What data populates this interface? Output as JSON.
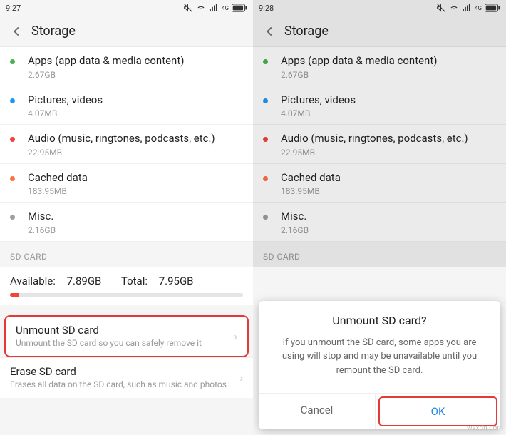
{
  "left": {
    "time": "9:27",
    "header_title": "Storage",
    "items": [
      {
        "dot": "dot-green",
        "title": "Apps (app data & media content)",
        "sub": "2.67GB"
      },
      {
        "dot": "dot-blue",
        "title": "Pictures, videos",
        "sub": "4.07MB"
      },
      {
        "dot": "dot-red",
        "title": "Audio (music, ringtones, podcasts, etc.)",
        "sub": "22.95MB"
      },
      {
        "dot": "dot-orange",
        "title": "Cached data",
        "sub": "183.95MB"
      },
      {
        "dot": "dot-grey",
        "title": "Misc.",
        "sub": "2.16GB"
      }
    ],
    "section_header": "SD CARD",
    "sd_available_label": "Available:",
    "sd_available_value": "7.89GB",
    "sd_total_label": "Total:",
    "sd_total_value": "7.95GB",
    "unmount_title": "Unmount SD card",
    "unmount_sub": "Unmount the SD card so you can safely remove it",
    "erase_title": "Erase SD card",
    "erase_sub": "Erases all data on the SD card, such as music and photos"
  },
  "right": {
    "time": "9:28",
    "header_title": "Storage",
    "items": [
      {
        "dot": "dot-green",
        "title": "Apps (app data & media content)",
        "sub": "2.67GB"
      },
      {
        "dot": "dot-blue",
        "title": "Pictures, videos",
        "sub": "4.07MB"
      },
      {
        "dot": "dot-red",
        "title": "Audio (music, ringtones, podcasts, etc.)",
        "sub": "22.95MB"
      },
      {
        "dot": "dot-orange",
        "title": "Cached data",
        "sub": "183.95MB"
      },
      {
        "dot": "dot-grey",
        "title": "Misc.",
        "sub": "2.16GB"
      }
    ],
    "section_header": "SD CARD",
    "dialog_title": "Unmount SD card?",
    "dialog_body": "If you unmount the SD card, some apps you are using will stop and may be unavailable until you remount the SD card.",
    "cancel": "Cancel",
    "ok": "OK"
  },
  "watermark": "wsxdn.com"
}
